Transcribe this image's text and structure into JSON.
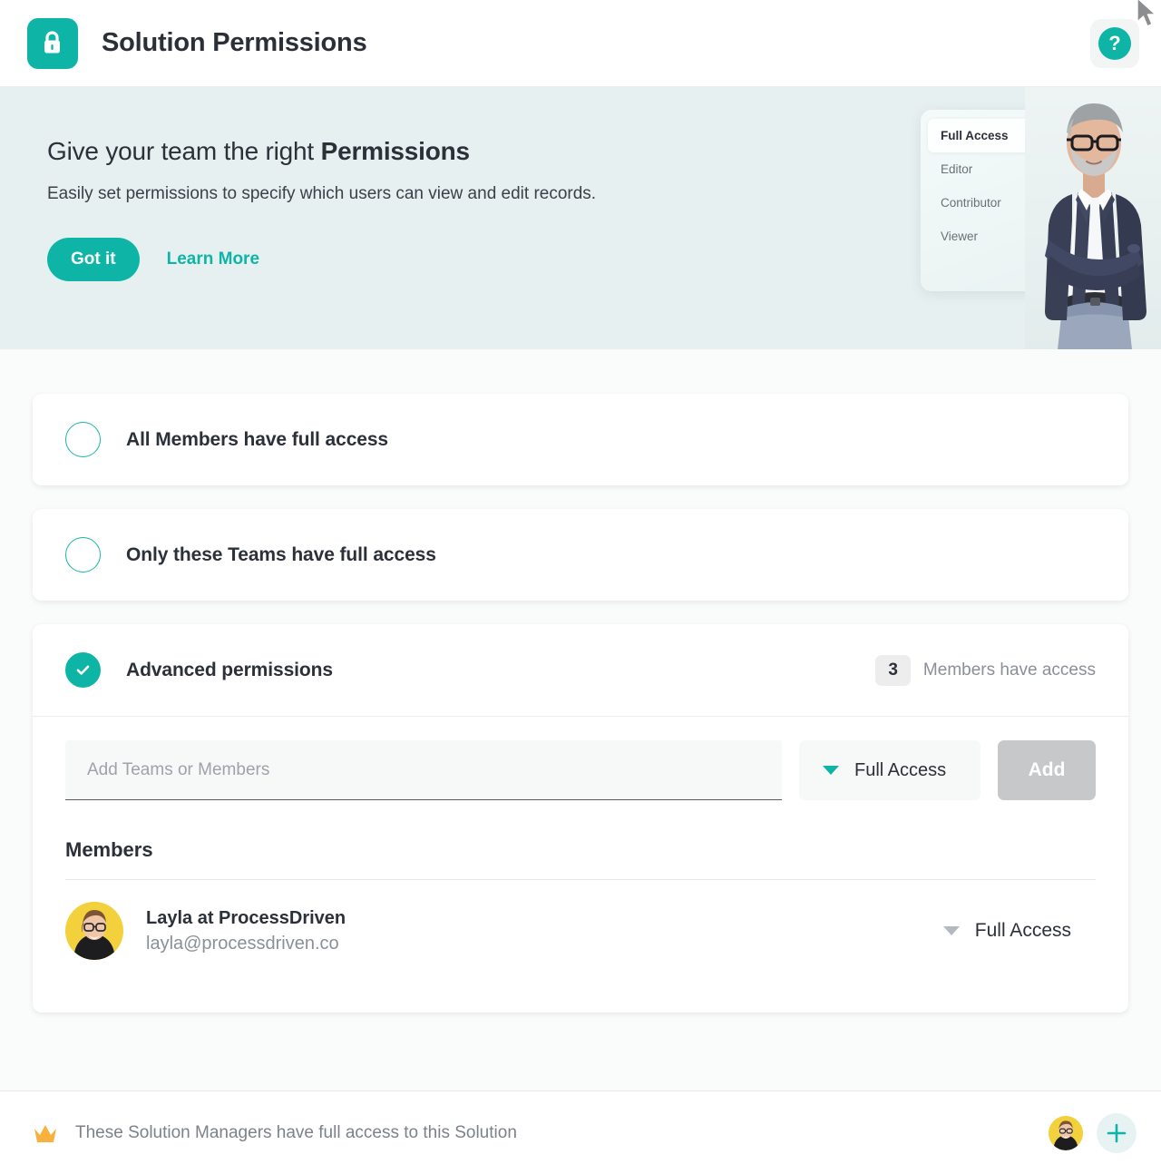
{
  "header": {
    "title": "Solution Permissions",
    "app_icon": "lock-icon",
    "help_label": "?"
  },
  "banner": {
    "heading_prefix": "Give your team the right ",
    "heading_bold": "Permissions",
    "subtitle": "Easily set permissions to specify which users can view and edit records.",
    "got_it_label": "Got it",
    "learn_more_label": "Learn More",
    "illustration": {
      "options": [
        {
          "label": "Full Access",
          "active": true
        },
        {
          "label": "Editor",
          "active": false
        },
        {
          "label": "Contributor",
          "active": false
        },
        {
          "label": "Viewer",
          "active": false
        }
      ],
      "cursor": "pointing-hand-cursor",
      "photo": "man-with-glasses-arms-crossed"
    },
    "background_color": "#e7f0f0"
  },
  "permissions": {
    "options": [
      {
        "label": "All Members have full access",
        "selected": false
      },
      {
        "label": "Only these Teams have full access",
        "selected": false
      },
      {
        "label": "Advanced permissions",
        "selected": true
      }
    ],
    "advanced": {
      "member_count": "3",
      "member_count_text": "Members have access",
      "add_input_placeholder": "Add Teams or Members",
      "add_input_value": "",
      "role_selected": "Full Access",
      "add_button_label": "Add",
      "members_heading": "Members",
      "members": [
        {
          "name": "Layla at ProcessDriven",
          "email": "layla@processdriven.co",
          "role": "Full Access",
          "avatar": "layla-avatar"
        }
      ]
    }
  },
  "footer": {
    "crown_icon": "crown-icon",
    "text": "These Solution Managers have full access to this Solution",
    "manager_avatar": "layla-avatar",
    "add_manager_label": "+"
  },
  "colors": {
    "accent": "#0eb5a6",
    "banner_bg": "#e7f0f0",
    "page_bg": "#fafbfb",
    "crown": "#f9b13e",
    "avatar_bg": "#f3d13c",
    "disabled_button": "#c6c8ca"
  }
}
